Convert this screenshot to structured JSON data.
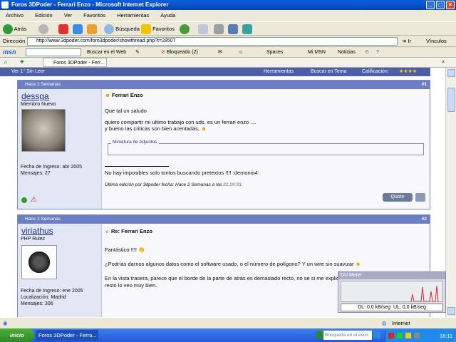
{
  "window": {
    "title": "Foros 3DPoder - Ferrari Enzo - Microsoft Internet Explorer"
  },
  "menu": [
    "Archivo",
    "Edición",
    "Ver",
    "Favoritos",
    "Herramientas",
    "Ayuda"
  ],
  "toolbar": {
    "back": "Atrás",
    "search": "Búsqueda",
    "favorites": "Favoritos"
  },
  "address": {
    "label": "Dirección",
    "url": "http://www.3dpoder.com/foro3dpoder/showthread.php?t=28507",
    "go": "Ir",
    "links": "Vínculos"
  },
  "msn": {
    "logo": "msn",
    "search_web": "Buscar en el Web",
    "blocked": "Bloqueado (2)",
    "spaces": "Spaces",
    "mymsn": "Mi MSN",
    "news": "Noticias"
  },
  "tab": {
    "label": "Foros 3DPoder - Ferr..."
  },
  "forum_bar": {
    "view": "Ver 1° Sin Leer",
    "tools": "Herramientas",
    "search_thread": "Buscar en Tema",
    "rating": "Calificación:",
    "stars": "★★★★"
  },
  "posts": [
    {
      "date": "Hace 2 Semanas",
      "number": "#1",
      "username": "dessga",
      "rank": "Miembro Nuevo",
      "join": "Fecha de Ingreso: abr 2005",
      "messages": "Mensajes: 27",
      "title": "Ferrari Enzo",
      "lines": [
        "Que tal un saludo",
        "quiero compartir mi ultimo trabajo con uds. es un ferrari enzo ....",
        "y bueno las criticas son bien acentadas,"
      ],
      "attachments": "Miniatura de Adjuntos",
      "signature": "No hay imposibles solo tontos buscando pretextos !!!! :demonio4:",
      "edit_prefix": "Última edición por 3dpoder fecha: Hace 2 Semanas a las",
      "edit_time": "21:29:33.",
      "quote": "Quote"
    },
    {
      "date": "Hace 2 Semanas",
      "number": "#2",
      "username": "viriathus",
      "rank": "PHP Rulez",
      "join": "Fecha de Ingreso: ene 2005",
      "location": "Localización: Madrid",
      "messages": "Mensajes: 306",
      "title": "Re: Ferrari Enzo",
      "lines": [
        "Fantástico !!!!",
        "¿Podrías darnos algunos datos como el software usado, o el número de polígono? Y un wire sin suavizar",
        "En la vista trasera, parece que el borde de la parte de atrás es demasiado recto, no se si me explico. El",
        "resto lo veo muy bien."
      ]
    }
  ],
  "dumeter": {
    "title": "DU Meter",
    "dl": "DL: 0,0 kB/seg",
    "ul": "UL: 0,0 kB/seg"
  },
  "statusbar": {
    "zone": "Internet"
  },
  "taskbar": {
    "start": "Inicio",
    "task": "Foros 3DPoder - Ferra...",
    "search_placeholder": "Búsqueda en el escri",
    "clock": "18:11"
  }
}
